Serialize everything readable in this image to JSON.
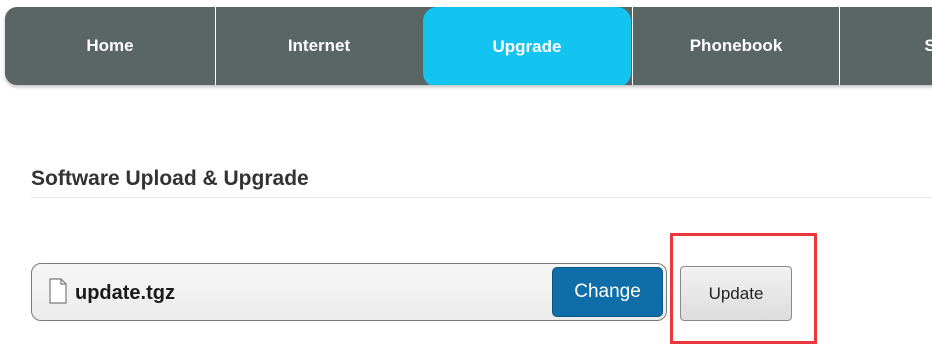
{
  "nav": {
    "items": [
      {
        "label": "Home"
      },
      {
        "label": "Internet"
      },
      {
        "label": "Upgrade",
        "active": true
      },
      {
        "label": "Phonebook"
      },
      {
        "label": "S"
      }
    ]
  },
  "section": {
    "title": "Software Upload & Upgrade"
  },
  "upload": {
    "file_name": "update.tgz",
    "change_label": "Change",
    "update_label": "Update"
  },
  "colors": {
    "nav_background": "#5a6664",
    "nav_active": "#14c4f0",
    "change_button": "#0f6ea8",
    "highlight": "#e8383d"
  },
  "icons": {
    "file": "file-icon"
  }
}
